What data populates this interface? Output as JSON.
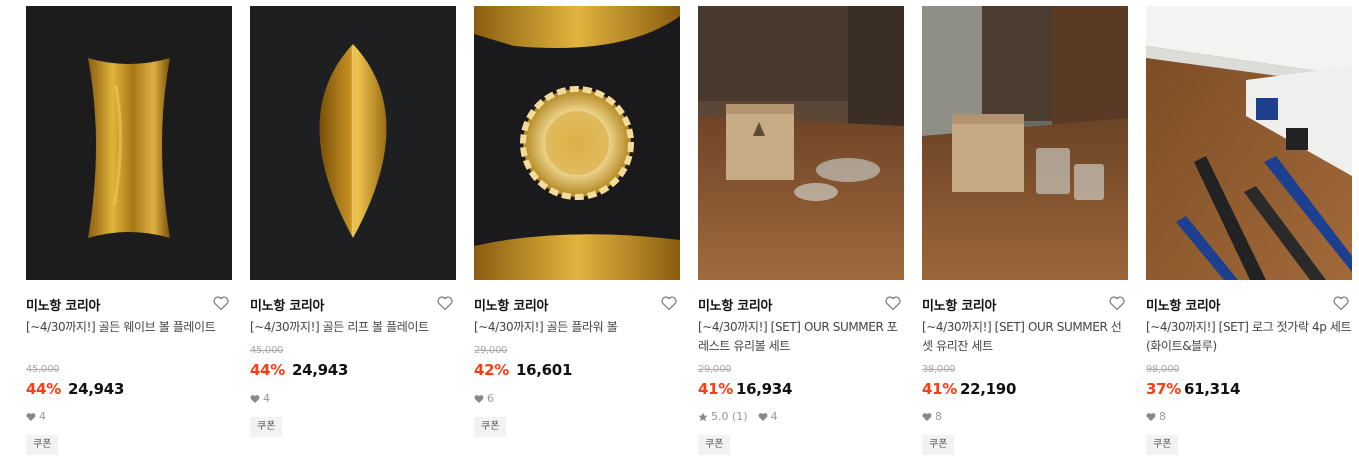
{
  "products": [
    {
      "brand": "미노항 코리아",
      "title": "[~4/30까지!] 골든 웨이브 볼 플레이트",
      "original_price": "45,000",
      "discount": "44%",
      "price": "24,943",
      "likes": "4",
      "rating": "",
      "coupon": "쿠폰",
      "image_icon": "gold-wave-plate-image"
    },
    {
      "brand": "미노항 코리아",
      "title": "[~4/30까지!] 골든 리프 볼 플레이트",
      "original_price": "45,000",
      "discount": "44%",
      "price": "24,943",
      "likes": "4",
      "rating": "",
      "coupon": "쿠폰",
      "image_icon": "gold-leaf-plate-image"
    },
    {
      "brand": "미노항 코리아",
      "title": "[~4/30까지!] 골든 플라워 볼",
      "original_price": "29,000",
      "discount": "42%",
      "price": "16,601",
      "likes": "6",
      "rating": "",
      "coupon": "쿠폰",
      "image_icon": "gold-flower-bowl-image"
    },
    {
      "brand": "미노항 코리아",
      "title": "[~4/30까지!] [SET] OUR SUMMER 포레스트 유리볼 세트",
      "original_price": "29,000",
      "discount": "41%",
      "price": "16,934",
      "likes": "4",
      "rating": "5.0 (1)",
      "coupon": "쿠폰",
      "image_icon": "glass-bowl-set-image"
    },
    {
      "brand": "미노항 코리아",
      "title": "[~4/30까지!] [SET] OUR SUMMER 선셋 유리잔 세트",
      "original_price": "38,000",
      "discount": "41%",
      "price": "22,190",
      "likes": "8",
      "rating": "",
      "coupon": "쿠폰",
      "image_icon": "glass-cup-set-image"
    },
    {
      "brand": "미노항 코리아",
      "title": "[~4/30까지!] [SET] 로그 젓가락 4p 세트 (화이트&블루)",
      "original_price": "98,000",
      "discount": "37%",
      "price": "61,314",
      "likes": "8",
      "rating": "",
      "coupon": "쿠폰",
      "image_icon": "chopsticks-set-image"
    }
  ],
  "colors": {
    "discount": "#ff3b14",
    "gold": "#c9971e",
    "dark_bg": "#1b1b1b",
    "wood": "#8a5a30"
  }
}
